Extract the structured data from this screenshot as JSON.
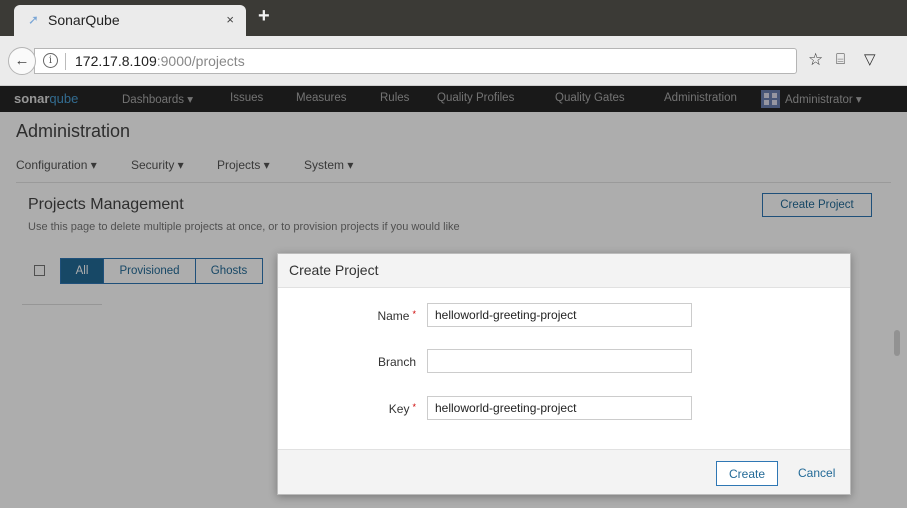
{
  "browser": {
    "tab_title": "SonarQube",
    "tab_close": "×",
    "new_tab": "+",
    "url_host": "172.17.8.109",
    "url_rest": ":9000/projects"
  },
  "sonar": {
    "logo_main": "sonar",
    "logo_q": "qube",
    "menu": [
      "Dashboards ▾",
      "Issues",
      "Measures",
      "Rules",
      "Quality Profiles",
      "Quality Gates",
      "Administration",
      "Administrator ▾"
    ]
  },
  "admin": {
    "heading": "Administration",
    "subnav": [
      "Configuration ▾",
      "Security ▾",
      "Projects ▾",
      "System ▾"
    ]
  },
  "projects_management": {
    "title": "Projects Management",
    "description": "Use this page to delete multiple projects at once, or to provision projects if you would like",
    "create_button": "Create Project",
    "filters": [
      "All",
      "Provisioned",
      "Ghosts"
    ]
  },
  "modal": {
    "title": "Create Project",
    "name_label": "Name",
    "name_value": "helloworld-greeting-project",
    "branch_label": "Branch",
    "branch_value": "",
    "key_label": "Key",
    "key_value": "helloworld-greeting-project",
    "required_mark": "*",
    "create_button": "Create",
    "cancel_link": "Cancel"
  },
  "colors": {
    "accent": "#236a97",
    "navbar": "#262626",
    "required": "#cc0000"
  }
}
